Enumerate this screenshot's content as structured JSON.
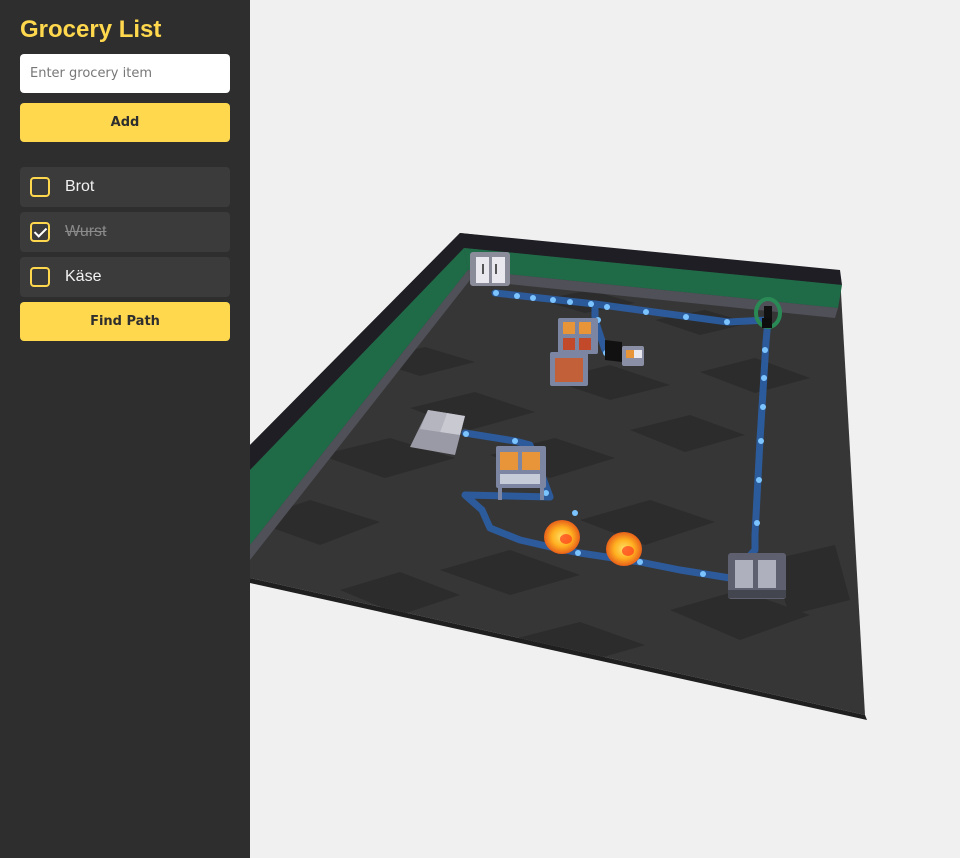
{
  "sidebar": {
    "title": "Grocery List",
    "input": {
      "placeholder": "Enter grocery item",
      "value": ""
    },
    "add_label": "Add",
    "items": [
      {
        "label": "Brot",
        "checked": false
      },
      {
        "label": "Wurst",
        "checked": true
      },
      {
        "label": "Käse",
        "checked": false
      }
    ],
    "find_path_label": "Find Path"
  },
  "scene": {
    "colors": {
      "floor_dark": "#333333",
      "floor_light": "#3d3d3d",
      "wall_top": "#4a4a52",
      "wall_stripe": "#1f6b47",
      "path": "#2b5fa6",
      "path_node": "#7cc4ff",
      "hazard": "#ffb020"
    },
    "objects": [
      "fridge-icon",
      "shelf-icon",
      "cart-icon",
      "checkout-icon",
      "entrance-icon",
      "hazard-icon"
    ]
  }
}
